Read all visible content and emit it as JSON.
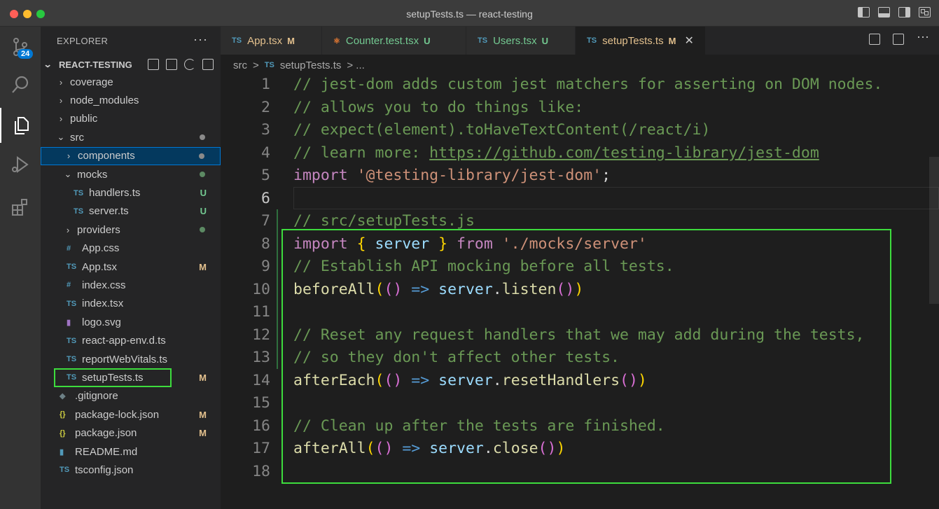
{
  "window": {
    "title": "setupTests.ts — react-testing"
  },
  "activity": {
    "scm_badge": "24"
  },
  "explorer": {
    "header": "EXPLORER",
    "more": "···",
    "project": "REACT-TESTING",
    "items": [
      {
        "label": "coverage",
        "type": "folder",
        "open": false,
        "indent": 0,
        "status": ""
      },
      {
        "label": "node_modules",
        "type": "folder",
        "open": false,
        "indent": 0,
        "status": ""
      },
      {
        "label": "public",
        "type": "folder",
        "open": false,
        "indent": 0,
        "status": ""
      },
      {
        "label": "src",
        "type": "folder",
        "open": true,
        "indent": 0,
        "status": "dot-dim"
      },
      {
        "label": "components",
        "type": "folder",
        "open": false,
        "indent": 1,
        "status": "dot-dim",
        "selected": true
      },
      {
        "label": "mocks",
        "type": "folder",
        "open": true,
        "indent": 1,
        "status": "dot-u"
      },
      {
        "label": "handlers.ts",
        "type": "ts",
        "indent": 2,
        "status": "U"
      },
      {
        "label": "server.ts",
        "type": "ts",
        "indent": 2,
        "status": "U"
      },
      {
        "label": "providers",
        "type": "folder",
        "open": false,
        "indent": 1,
        "status": "dot-u"
      },
      {
        "label": "App.css",
        "type": "css",
        "indent": 1,
        "status": ""
      },
      {
        "label": "App.tsx",
        "type": "ts",
        "indent": 1,
        "status": "M"
      },
      {
        "label": "index.css",
        "type": "css",
        "indent": 1,
        "status": ""
      },
      {
        "label": "index.tsx",
        "type": "ts",
        "indent": 1,
        "status": ""
      },
      {
        "label": "logo.svg",
        "type": "svg",
        "indent": 1,
        "status": ""
      },
      {
        "label": "react-app-env.d.ts",
        "type": "ts",
        "indent": 1,
        "status": ""
      },
      {
        "label": "reportWebVitals.ts",
        "type": "ts",
        "indent": 1,
        "status": ""
      },
      {
        "label": "setupTests.ts",
        "type": "ts",
        "indent": 1,
        "status": "M"
      },
      {
        "label": ".gitignore",
        "type": "git",
        "indent": 0,
        "status": ""
      },
      {
        "label": "package-lock.json",
        "type": "json",
        "indent": 0,
        "status": "M"
      },
      {
        "label": "package.json",
        "type": "json",
        "indent": 0,
        "status": "M"
      },
      {
        "label": "README.md",
        "type": "md",
        "indent": 0,
        "status": ""
      },
      {
        "label": "tsconfig.json",
        "type": "ts",
        "indent": 0,
        "status": ""
      }
    ]
  },
  "icon_glyphs": {
    "ts": "TS",
    "css": "#",
    "json": "{}",
    "svg": "▮",
    "git": "◆",
    "md": "▮"
  },
  "tabs": [
    {
      "label": "App.tsx",
      "icon": "TS",
      "status": "M",
      "active": false
    },
    {
      "label": "Counter.test.tsx",
      "icon": "⚛",
      "status": "U",
      "active": false
    },
    {
      "label": "Users.tsx",
      "icon": "TS",
      "status": "U",
      "active": false
    },
    {
      "label": "setupTests.ts",
      "icon": "TS",
      "status": "M",
      "active": true
    }
  ],
  "tab_close": "✕",
  "breadcrumb": {
    "folder": "src",
    "sep": ">",
    "icon": "TS",
    "file": "setupTests.ts",
    "tail": "> ..."
  },
  "editor": {
    "current_line": 6,
    "lines": [
      [
        [
          "com",
          "// jest-dom adds custom jest matchers for asserting on DOM nodes."
        ]
      ],
      [
        [
          "com",
          "// allows you to do things like:"
        ]
      ],
      [
        [
          "com",
          "// expect(element).toHaveTextContent(/react/i)"
        ]
      ],
      [
        [
          "com",
          "// learn more: "
        ],
        [
          "link",
          "https://github.com/testing-library/jest-dom"
        ]
      ],
      [
        [
          "kw",
          "import "
        ],
        [
          "str",
          "'@testing-library/jest-dom'"
        ],
        [
          "plain",
          ";"
        ]
      ],
      [],
      [
        [
          "com",
          "// src/setupTests.js"
        ]
      ],
      [
        [
          "kw",
          "import "
        ],
        [
          "p1",
          "{ "
        ],
        [
          "var",
          "server"
        ],
        [
          "p1",
          " }"
        ],
        [
          "kw",
          " from "
        ],
        [
          "str",
          "'./mocks/server'"
        ]
      ],
      [
        [
          "com",
          "// Establish API mocking before all tests."
        ]
      ],
      [
        [
          "fn",
          "beforeAll"
        ],
        [
          "p1",
          "("
        ],
        [
          "p2",
          "()"
        ],
        [
          "op",
          " => "
        ],
        [
          "var",
          "server"
        ],
        [
          "plain",
          "."
        ],
        [
          "fn",
          "listen"
        ],
        [
          "p2",
          "()"
        ],
        [
          "p1",
          ")"
        ]
      ],
      [],
      [
        [
          "com",
          "// Reset any request handlers that we may add during the tests,"
        ]
      ],
      [
        [
          "com",
          "// so they don't affect other tests."
        ]
      ],
      [
        [
          "fn",
          "afterEach"
        ],
        [
          "p1",
          "("
        ],
        [
          "p2",
          "()"
        ],
        [
          "op",
          " => "
        ],
        [
          "var",
          "server"
        ],
        [
          "plain",
          "."
        ],
        [
          "fn",
          "resetHandlers"
        ],
        [
          "p2",
          "()"
        ],
        [
          "p1",
          ")"
        ]
      ],
      [],
      [
        [
          "com",
          "// Clean up after the tests are finished."
        ]
      ],
      [
        [
          "fn",
          "afterAll"
        ],
        [
          "p1",
          "("
        ],
        [
          "p2",
          "()"
        ],
        [
          "op",
          " => "
        ],
        [
          "var",
          "server"
        ],
        [
          "plain",
          "."
        ],
        [
          "fn",
          "close"
        ],
        [
          "p2",
          "()"
        ],
        [
          "p1",
          ")"
        ]
      ],
      []
    ]
  }
}
